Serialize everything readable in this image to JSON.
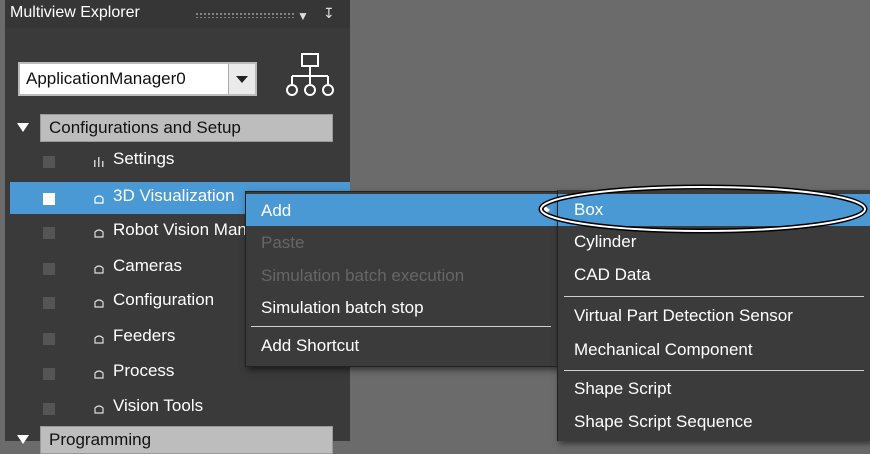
{
  "sidebar": {
    "title": "Multiview Explorer",
    "dropdown_icon": "chevron-down-icon",
    "pin_icon": "pin-icon",
    "pin_glyph": "↧",
    "application_select": "ApplicationManager0",
    "groups": [
      {
        "label": "Configurations and Setup",
        "expanded": true
      },
      {
        "label": "Programming",
        "expanded": true
      }
    ],
    "items": [
      {
        "label": "Settings",
        "icon": "settings-icon"
      },
      {
        "label": "3D Visualization",
        "icon": "folder-icon"
      },
      {
        "label": "Robot Vision Manager",
        "icon": "folder-icon"
      },
      {
        "label": "Cameras",
        "icon": "folder-icon"
      },
      {
        "label": "Configuration",
        "icon": "folder-icon"
      },
      {
        "label": "Feeders",
        "icon": "folder-icon"
      },
      {
        "label": "Process",
        "icon": "folder-icon"
      },
      {
        "label": "Vision Tools",
        "icon": "folder-icon"
      }
    ]
  },
  "context_menu": {
    "items": [
      {
        "label": "Add",
        "enabled": true,
        "highlighted": true
      },
      {
        "label": "Paste",
        "enabled": false
      },
      {
        "label": "Simulation batch execution",
        "enabled": false
      },
      {
        "label": "Simulation batch stop",
        "enabled": true
      },
      {
        "label": "Add Shortcut",
        "enabled": true
      }
    ]
  },
  "submenu": {
    "items": [
      {
        "label": "Box",
        "highlighted": true
      },
      {
        "label": "Cylinder"
      },
      {
        "label": "CAD Data"
      },
      {
        "label": "Virtual Part Detection Sensor"
      },
      {
        "label": "Mechanical Component"
      },
      {
        "label": "Shape Script"
      },
      {
        "label": "Shape Script Sequence"
      }
    ]
  },
  "colors": {
    "highlight": "#4a98d4",
    "panel": "#3a3a3a",
    "background": "#6b6b6b"
  }
}
